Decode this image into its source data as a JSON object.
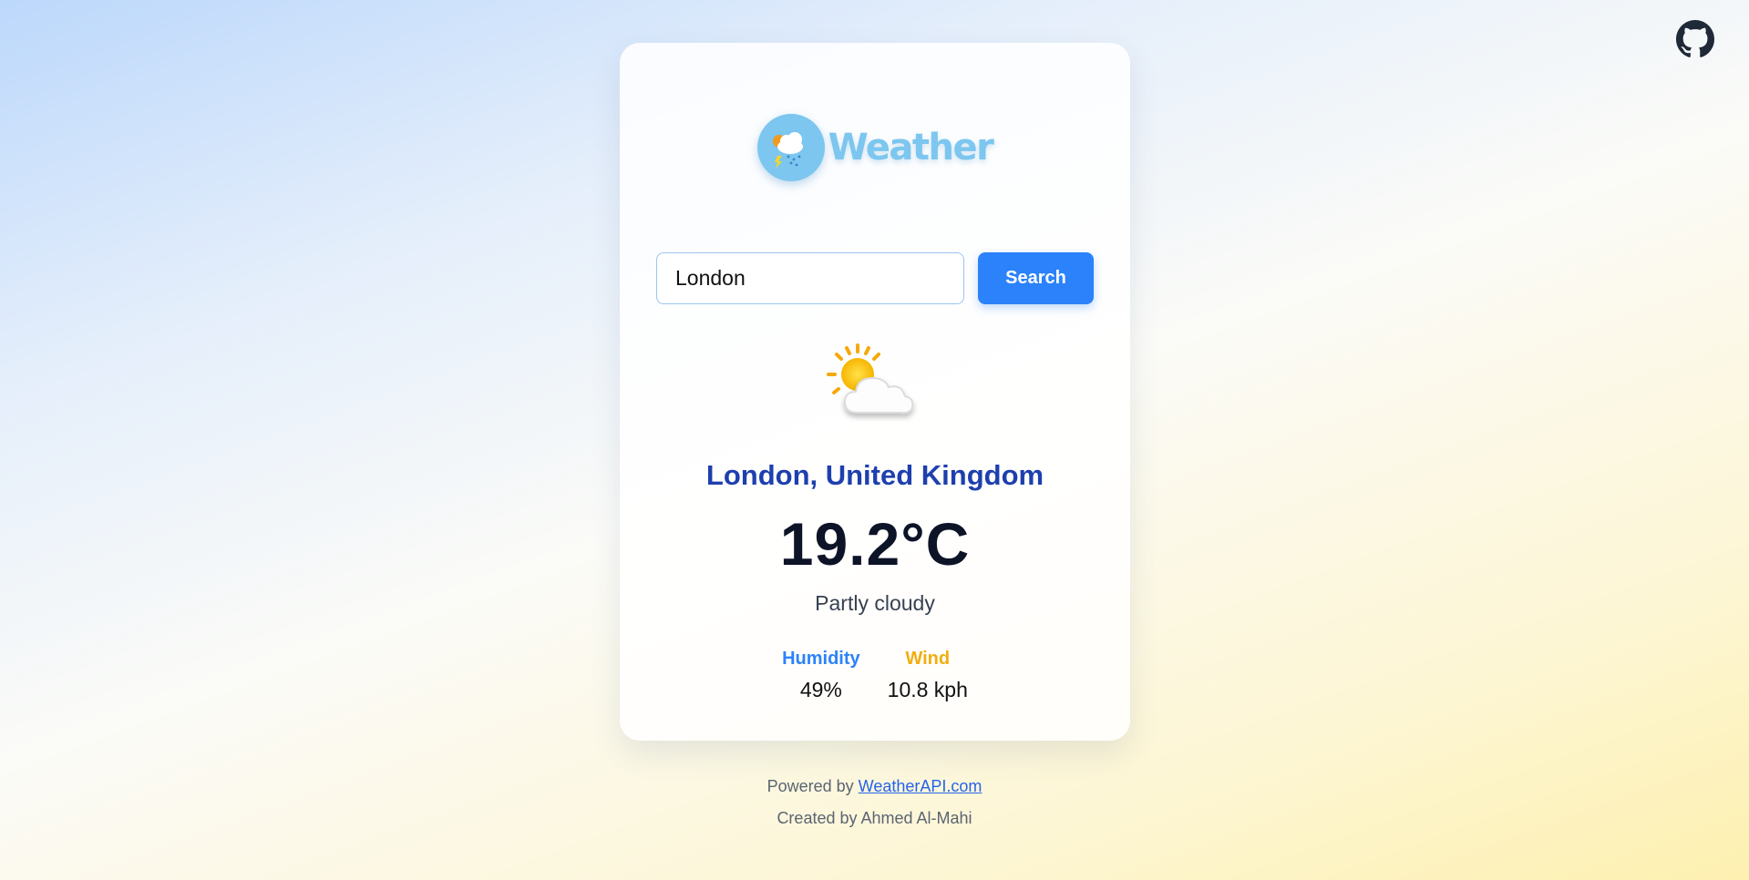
{
  "header": {
    "github_icon": "github-icon"
  },
  "logo": {
    "icon": "cloud-lightning-rain-icon",
    "text": "Weather"
  },
  "search": {
    "value": "London",
    "button_label": "Search"
  },
  "weather": {
    "icon": "partly-cloudy-icon",
    "location": "London, United Kingdom",
    "temperature": "19.2°C",
    "condition": "Partly cloudy",
    "humidity_label": "Humidity",
    "humidity_value": "49%",
    "wind_label": "Wind",
    "wind_value": "10.8 kph"
  },
  "footer": {
    "powered_prefix": "Powered by",
    "powered_link": "WeatherAPI.com",
    "credit": "Created by Ahmed Al-Mahi"
  },
  "colors": {
    "accent": "#2b82fa",
    "location": "#1e3fae",
    "humidity": "#2b82fa",
    "wind": "#f0ae0f",
    "logo": "#7cc6ef"
  }
}
